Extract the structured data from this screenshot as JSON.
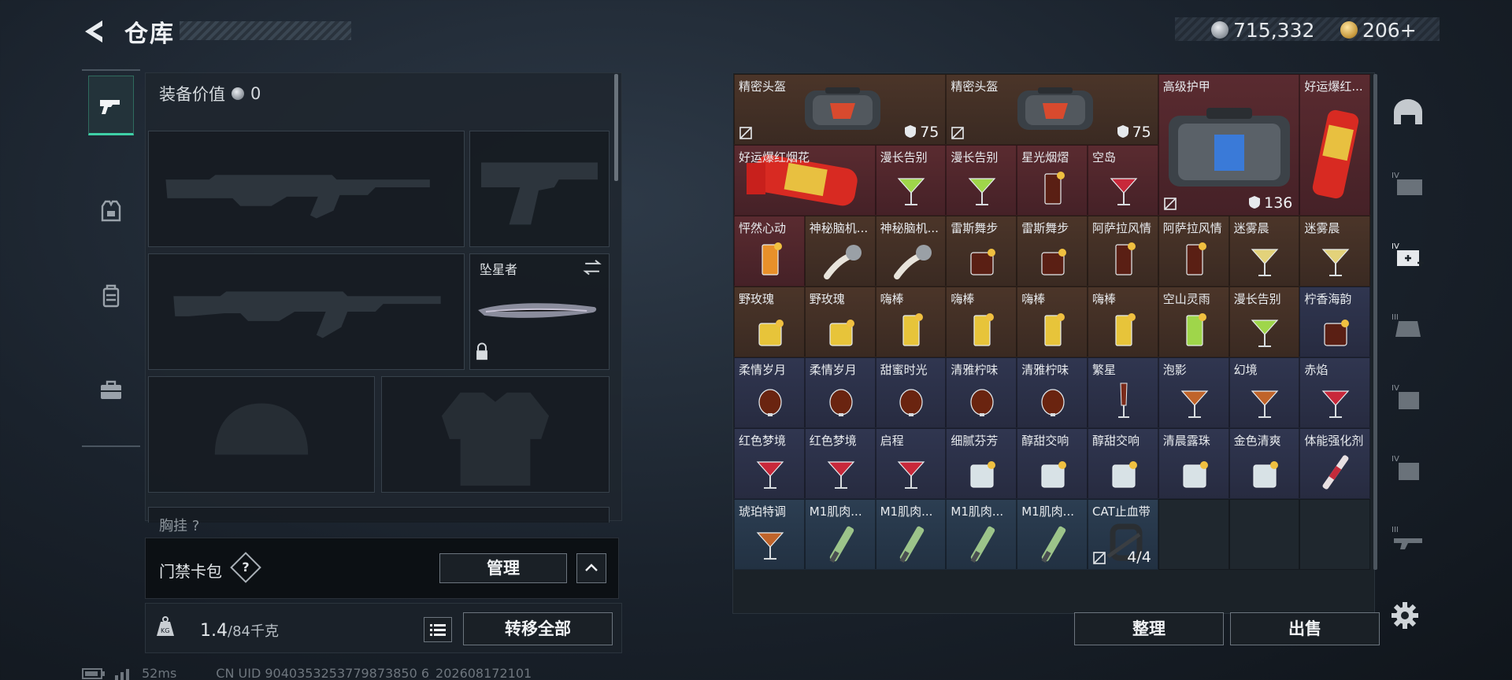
{
  "header": {
    "title": "仓库",
    "silver": "715,332",
    "gold": "206+"
  },
  "equipment": {
    "value_label": "装备价值",
    "value": "0",
    "melee_name": "坠星者",
    "chest_label": "胸挂 ?",
    "access_label": "门禁卡包",
    "access_help": "?",
    "manage_label": "管理",
    "weight_current": "1.4",
    "weight_max": "/84千克",
    "transfer_all_label": "转移全部"
  },
  "status": {
    "ping": "52ms",
    "uid": "CN UID 9040353253779873850 6_202608172101"
  },
  "grid_items": [
    {
      "name": "精密头盔",
      "durability": "75",
      "color": "brown"
    },
    {
      "name": "精密头盔",
      "durability": "75",
      "color": "brown"
    },
    {
      "name": "高级护甲",
      "durability": "136",
      "color": "red"
    },
    {
      "name": "好运爆红...",
      "color": "red"
    },
    {
      "name": "好运爆红烟花",
      "color": "red"
    },
    {
      "name": "漫长告别",
      "color": "red"
    },
    {
      "name": "漫长告别",
      "color": "red"
    },
    {
      "name": "星光烟熠",
      "color": "red"
    },
    {
      "name": "空岛",
      "color": "red"
    },
    {
      "name": "怦然心动",
      "color": "red"
    },
    {
      "name": "神秘脑机...",
      "color": "brown"
    },
    {
      "name": "神秘脑机...",
      "color": "brown"
    },
    {
      "name": "雷斯舞步",
      "color": "brown"
    },
    {
      "name": "雷斯舞步",
      "color": "brown"
    },
    {
      "name": "阿萨拉风情",
      "color": "brown"
    },
    {
      "name": "阿萨拉风情",
      "color": "brown"
    },
    {
      "name": "迷雾晨",
      "color": "brown"
    },
    {
      "name": "迷雾晨",
      "color": "brown"
    },
    {
      "name": "野玫瑰",
      "color": "brown"
    },
    {
      "name": "野玫瑰",
      "color": "brown"
    },
    {
      "name": "嗨棒",
      "color": "brown"
    },
    {
      "name": "嗨棒",
      "color": "brown"
    },
    {
      "name": "嗨棒",
      "color": "brown"
    },
    {
      "name": "嗨棒",
      "color": "brown"
    },
    {
      "name": "空山灵雨",
      "color": "brown"
    },
    {
      "name": "漫长告别",
      "color": "brown"
    },
    {
      "name": "柠香海韵",
      "color": "navy"
    },
    {
      "name": "柔情岁月",
      "color": "navy"
    },
    {
      "name": "柔情岁月",
      "color": "navy"
    },
    {
      "name": "甜蜜时光",
      "color": "navy"
    },
    {
      "name": "清雅柠味",
      "color": "navy"
    },
    {
      "name": "清雅柠味",
      "color": "navy"
    },
    {
      "name": "繁星",
      "color": "navy"
    },
    {
      "name": "泡影",
      "color": "navy"
    },
    {
      "name": "幻境",
      "color": "navy"
    },
    {
      "name": "赤焰",
      "color": "navy"
    },
    {
      "name": "红色梦境",
      "color": "navy"
    },
    {
      "name": "红色梦境",
      "color": "navy"
    },
    {
      "name": "启程",
      "color": "navy"
    },
    {
      "name": "细腻芬芳",
      "color": "navy"
    },
    {
      "name": "醇甜交响",
      "color": "navy"
    },
    {
      "name": "醇甜交响",
      "color": "navy"
    },
    {
      "name": "清晨露珠",
      "color": "navy"
    },
    {
      "name": "金色清爽",
      "color": "navy"
    },
    {
      "name": "体能强化剂",
      "color": "navy"
    },
    {
      "name": "琥珀特调",
      "color": "blue"
    },
    {
      "name": "M1肌肉...",
      "color": "blue"
    },
    {
      "name": "M1肌肉...",
      "color": "blue"
    },
    {
      "name": "M1肌肉...",
      "color": "blue"
    },
    {
      "name": "M1肌肉...",
      "color": "blue"
    },
    {
      "name": "CAT止血带",
      "durability": "4/4",
      "color": "blue"
    }
  ],
  "actions": {
    "sort_label": "整理",
    "sell_label": "出售"
  },
  "colors": {
    "accent": "#3fd0a6",
    "brown": "#4b3529",
    "red": "#5a2b30",
    "navy": "#303650",
    "blue": "#2c3e52"
  },
  "right_tabs": [
    {
      "icon": "helmet-category-icon"
    },
    {
      "icon": "tier4-armor-category-icon",
      "tier": "IV"
    },
    {
      "icon": "tier4-medical-category-icon",
      "tier": "IV"
    },
    {
      "icon": "tier3-armor-category-icon",
      "tier": "III"
    },
    {
      "icon": "tier4-backpack-category-icon",
      "tier": "IV"
    },
    {
      "icon": "tier4-pack-category-icon",
      "tier": "IV"
    },
    {
      "icon": "tier3-gun-category-icon",
      "tier": "III"
    }
  ]
}
